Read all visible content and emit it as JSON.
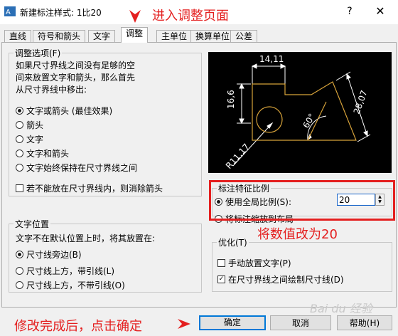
{
  "window": {
    "title": "新建标注样式: 1比20",
    "help_label": "?",
    "close_label": "✕",
    "app_icon": "autocad-icon"
  },
  "tabs": [
    "直线",
    "符号和箭头",
    "文字",
    "调整",
    "主单位",
    "换算单位",
    "公差"
  ],
  "active_tab": "调整",
  "fit_options": {
    "legend": "调整选项(F)",
    "description": [
      "如果尺寸界线之间没有足够的空",
      "间来放置文字和箭头，那么首先",
      "从尺寸界线中移出:"
    ],
    "options": [
      "文字或箭头 (最佳效果)",
      "箭头",
      "文字",
      "文字和箭头",
      "文字始终保持在尺寸界线之间"
    ],
    "selected": "文字或箭头 (最佳效果)",
    "suppress_arrows_label": "若不能放在尺寸界线内，则消除箭头",
    "suppress_arrows_checked": false
  },
  "text_placement": {
    "legend": "文字位置",
    "description": "文字不在默认位置上时，将其放置在:",
    "options": [
      "尺寸线旁边(B)",
      "尺寸线上方，带引线(L)",
      "尺寸线上方，不带引线(O)"
    ],
    "selected": "尺寸线旁边(B)"
  },
  "preview": {
    "dim_top": "14,11",
    "dim_left": "16,6",
    "dim_right": "28,07",
    "dim_angle": "60°",
    "dim_radius": "R11,17"
  },
  "scale": {
    "legend": "标注特征比例",
    "options": [
      "使用全局比例(S):",
      "将标注缩放到布局"
    ],
    "selected": "使用全局比例(S):",
    "value": "20"
  },
  "finetune": {
    "legend": "优化(T)",
    "manual_text_label": "手动放置文字(P)",
    "manual_text_checked": false,
    "draw_dimline_label": "在尺寸界线之间绘制尺寸线(D)",
    "draw_dimline_checked": true,
    "checkmark": "✓"
  },
  "buttons": {
    "ok": "确定",
    "cancel": "取消",
    "help": "帮助(H)"
  },
  "annotations": {
    "enter_page": "进入调整页面",
    "set_value": "将数值改为20",
    "finish": "修改完成后，点击确定",
    "color": "#e41f1f"
  },
  "watermark": "Bai du 经验"
}
